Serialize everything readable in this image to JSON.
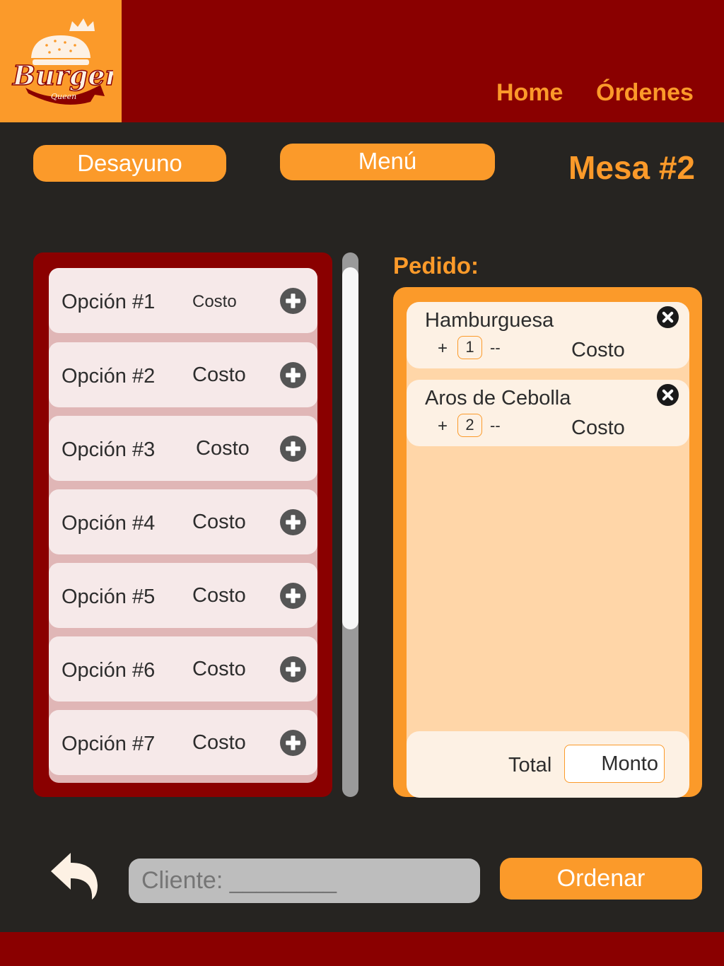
{
  "header": {
    "logo_text": "Burger",
    "logo_subtext": "Queen",
    "nav": [
      "Home",
      "Órdenes"
    ]
  },
  "controls": {
    "breakfast_label": "Desayuno",
    "menu_label": "Menú",
    "table_label": "Mesa #2"
  },
  "menu": {
    "items": [
      {
        "name": "Opción #1",
        "cost": "Costo"
      },
      {
        "name": "Opción #2",
        "cost": "Costo"
      },
      {
        "name": "Opción #3",
        "cost": "Costo"
      },
      {
        "name": "Opción #4",
        "cost": "Costo"
      },
      {
        "name": "Opción #5",
        "cost": "Costo"
      },
      {
        "name": "Opción #6",
        "cost": "Costo"
      },
      {
        "name": "Opción #7",
        "cost": "Costo"
      }
    ]
  },
  "order": {
    "label": "Pedido:",
    "items": [
      {
        "name": "Hamburguesa",
        "plus": "+",
        "qty": "1",
        "minus": "--",
        "cost": "Costo"
      },
      {
        "name": "Aros de Cebolla",
        "plus": "+",
        "qty": "2",
        "minus": "--",
        "cost": "Costo"
      }
    ],
    "total_label": "Total",
    "total_value": "Monto"
  },
  "footer_bar": {
    "client_placeholder": "Cliente: ________",
    "order_button": "Ordenar"
  },
  "icons": {
    "add": "plus-circle-icon",
    "remove": "x-circle-icon",
    "back": "undo-arrow-icon"
  },
  "colors": {
    "primary_red": "#8a0000",
    "accent_orange": "#fb9a2a",
    "background": "#262421",
    "order_inner": "#ffd6a8",
    "order_card": "#fdf1e4",
    "menu_card": "#f6e9e9"
  }
}
